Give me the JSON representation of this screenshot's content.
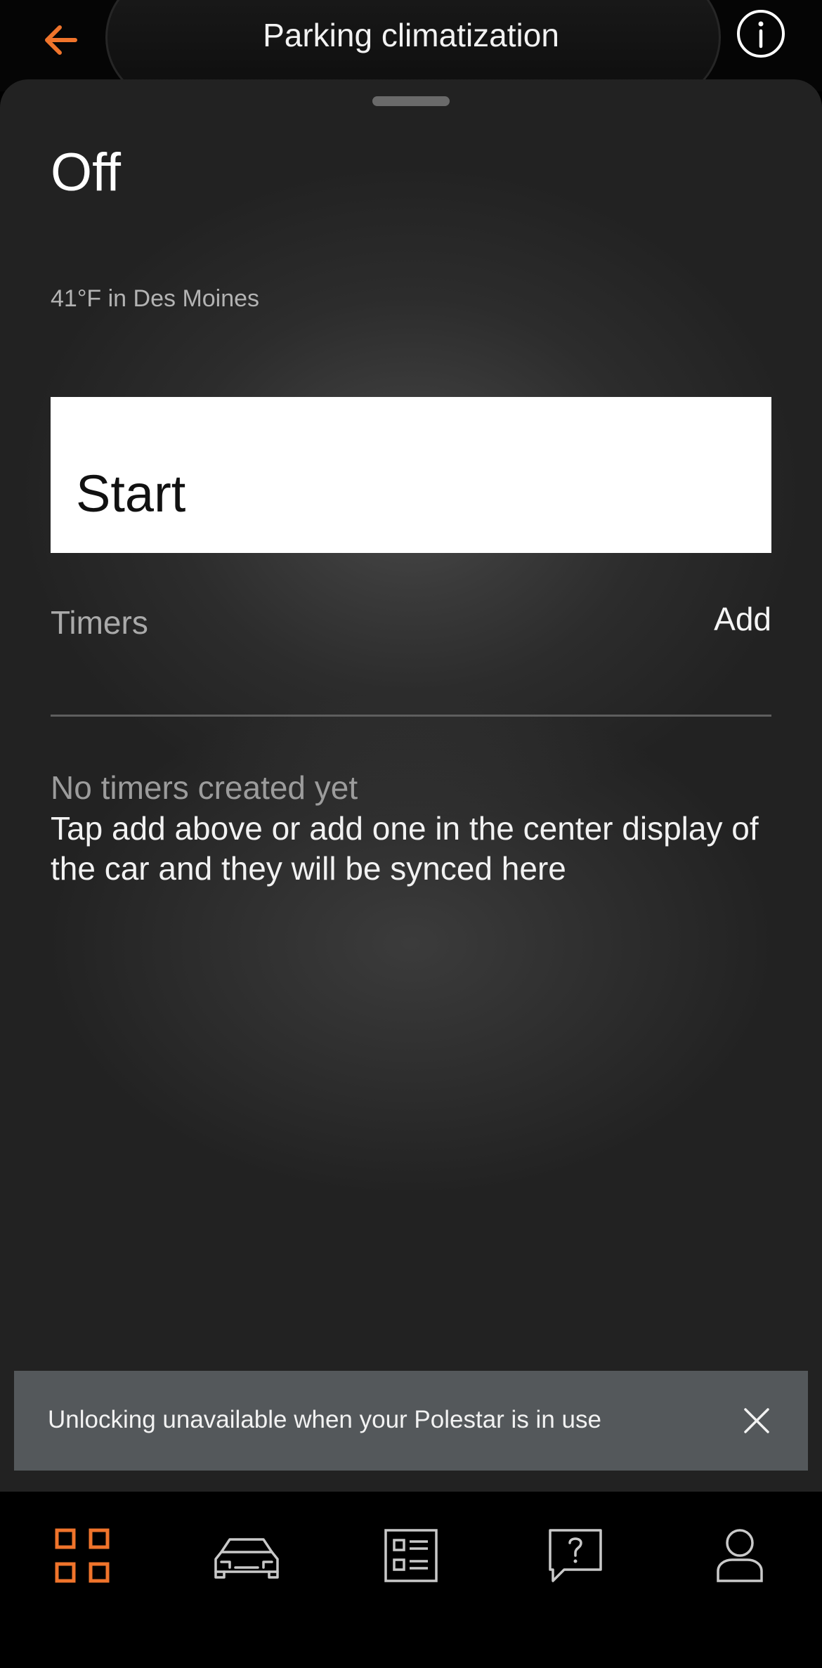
{
  "header": {
    "title": "Parking climatization",
    "back_icon": "arrow-left-icon",
    "info_icon": "info-icon"
  },
  "climate": {
    "status": "Off",
    "weather": "41°F in Des Moines",
    "start_label": "Start"
  },
  "timers": {
    "label": "Timers",
    "add_label": "Add",
    "empty_title": "No timers created yet",
    "empty_description": "Tap add above or add one in the center display of the car and they will be synced here"
  },
  "toast": {
    "message": "Unlocking unavailable when your Polestar is in use"
  },
  "bottom_nav": {
    "items": [
      {
        "icon": "dashboard-grid-icon",
        "active": true
      },
      {
        "icon": "car-icon",
        "active": false
      },
      {
        "icon": "list-icon",
        "active": false
      },
      {
        "icon": "help-chat-icon",
        "active": false
      },
      {
        "icon": "profile-icon",
        "active": false
      }
    ]
  },
  "colors": {
    "accent": "#f0742b",
    "background": "#000000",
    "sheet": "#2a2a2a",
    "toast": "#54585b"
  }
}
